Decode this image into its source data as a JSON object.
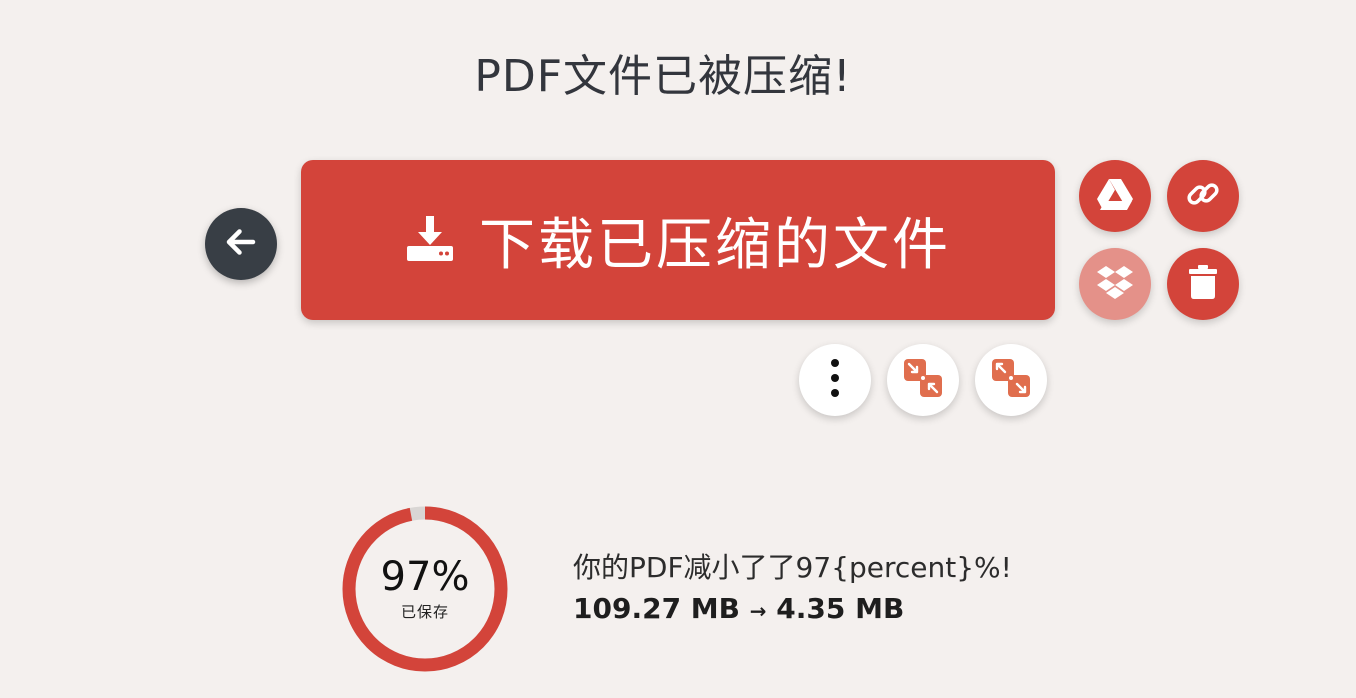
{
  "page": {
    "title": "PDF文件已被压缩!"
  },
  "actions": {
    "download_label": "下载已压缩的文件",
    "back_icon": "arrow-left-icon",
    "download_icon": "download-icon",
    "gdrive_icon": "google-drive-icon",
    "link_icon": "link-icon",
    "dropbox_icon": "dropbox-icon",
    "trash_icon": "trash-icon",
    "more_icon": "more-vertical-icon",
    "compress_icon": "compress-icon",
    "expand_icon": "expand-icon"
  },
  "result": {
    "percent_text": "97%",
    "percent_value": 97,
    "saved_label": "已保存",
    "message": "你的PDF减小了了97{percent}%!",
    "size_before": "109.27 MB",
    "arrow": "→",
    "size_after": "4.35 MB"
  },
  "colors": {
    "accent": "#d3443a",
    "accent_light": "#e49189",
    "dark_button": "#383e45",
    "background": "#f4f0ee",
    "ring_track": "#d9d6d4",
    "tool_icon": "#e06e4e"
  }
}
